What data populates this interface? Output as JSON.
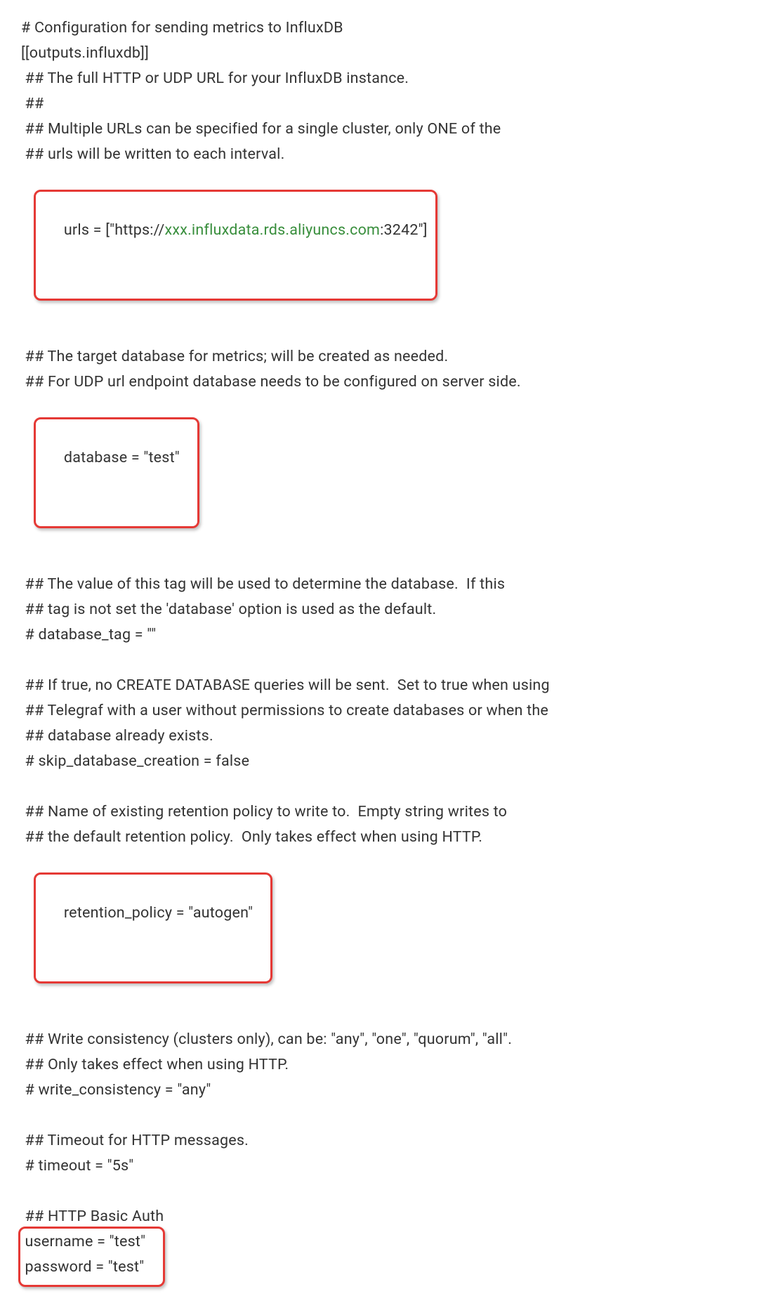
{
  "config": {
    "comment_header": "# Configuration for sending metrics to InfluxDB",
    "section_header": "[[outputs.influxdb]]",
    "urls_comment1": " ## The full HTTP or UDP URL for your InfluxDB instance.",
    "urls_comment2": " ##",
    "urls_comment3": " ## Multiple URLs can be specified for a single cluster, only ONE of the",
    "urls_comment4": " ## urls will be written to each interval.",
    "urls_assignment_prefix": " urls = [\"https://",
    "urls_host": "xxx.influxdata.rds.aliyuncs.com",
    "urls_assignment_suffix": ":3242\"]",
    "database_comment1": " ## The target database for metrics; will be created as needed.",
    "database_comment2": " ## For UDP url endpoint database needs to be configured on server side.",
    "database_assignment": " database = \"test\"",
    "database_tag_comment1": " ## The value of this tag will be used to determine the database.  If this",
    "database_tag_comment2": " ## tag is not set the 'database' option is used as the default.",
    "database_tag_assignment": " # database_tag = \"\"",
    "skip_db_comment1": " ## If true, no CREATE DATABASE queries will be sent.  Set to true when using",
    "skip_db_comment2": " ## Telegraf with a user without permissions to create databases or when the",
    "skip_db_comment3": " ## database already exists.",
    "skip_db_assignment": " # skip_database_creation = false",
    "retention_comment1": " ## Name of existing retention policy to write to.  Empty string writes to",
    "retention_comment2": " ## the default retention policy.  Only takes effect when using HTTP.",
    "retention_assignment": " retention_policy = \"autogen\"",
    "write_consistency_comment1": " ## Write consistency (clusters only), can be: \"any\", \"one\", \"quorum\", \"all\".",
    "write_consistency_comment2": " ## Only takes effect when using HTTP.",
    "write_consistency_assignment": " # write_consistency = \"any\"",
    "timeout_comment": " ## Timeout for HTTP messages.",
    "timeout_assignment": " # timeout = \"5s\"",
    "auth_comment": " ## HTTP Basic Auth",
    "username_assignment": " username = \"test\"",
    "password_assignment": " password = \"test\""
  }
}
